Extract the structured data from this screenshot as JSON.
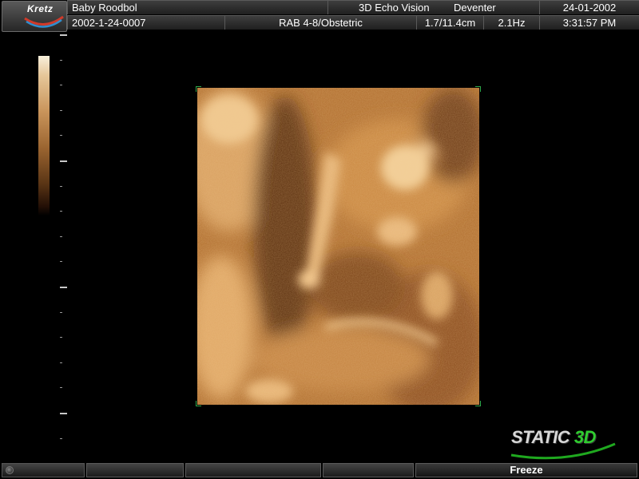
{
  "header": {
    "logo": "Kretz",
    "patient_name": "Baby Roodbol",
    "system_title": "3D Echo Vision",
    "location": "Deventer",
    "date": "24-01-2002",
    "patient_id": "2002-1-24-0007",
    "probe_preset": "RAB 4-8/Obstetric",
    "depth": "1.7/11.4cm",
    "frequency": "2.1Hz",
    "time": "3:31:57 PM"
  },
  "mode_badge": {
    "static": "STATIC",
    "three_d": "3D"
  },
  "footer": {
    "freeze_label": "Freeze"
  },
  "colors": {
    "accent_green": "#2fcc2f",
    "image_tint": "#c58a4a",
    "panel": "#2a2a2a"
  },
  "icons": [
    "kretz-logo-icon",
    "trackball-icon",
    "static-3d-logo-icon"
  ]
}
